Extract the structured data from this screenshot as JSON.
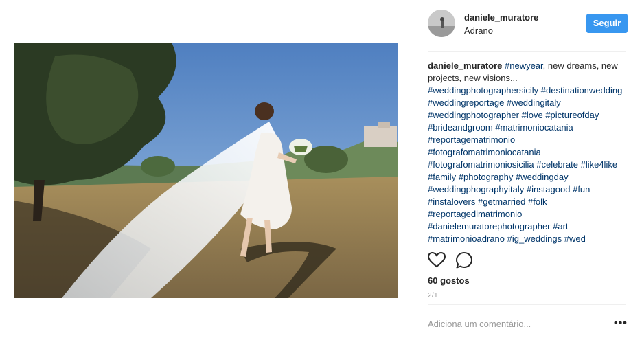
{
  "post": {
    "username": "daniele_muratore",
    "location": "Adrano",
    "follow_label": "Seguir",
    "caption": {
      "username": "daniele_muratore",
      "first_tag": "#newyear",
      "text": ", new dreams, new projects, new visions...",
      "hashtags": [
        "#weddingphotographersicily",
        "#destinationwedding",
        "#weddingreportage",
        "#weddingitaly",
        "#weddingphotographer",
        "#love",
        "#pictureofday",
        "#brideandgroom",
        "#matrimoniocatania",
        "#reportagematrimonio",
        "#fotografomatrimoniocatania",
        "#fotografomatrimoniosicilia",
        "#celebrate",
        "#like4like",
        "#family",
        "#photography",
        "#weddingday",
        "#weddingphographyitaly",
        "#instagood",
        "#fun",
        "#instalovers",
        "#getmarried",
        "#folk",
        "#reportagedimatrimonio",
        "#danielemuratorephotographer",
        "#art",
        "#matrimonioadrano",
        "#ig_weddings",
        "#wed"
      ]
    },
    "likes": "60 gostos",
    "pager": "2/1",
    "comment_placeholder": "Adiciona um comentário...",
    "more_label": "•••"
  },
  "icons": {
    "like": "heart-icon",
    "comment": "comment-icon",
    "more": "more-options-icon"
  },
  "colors": {
    "accent": "#3897f0",
    "hashtag": "#003569"
  }
}
